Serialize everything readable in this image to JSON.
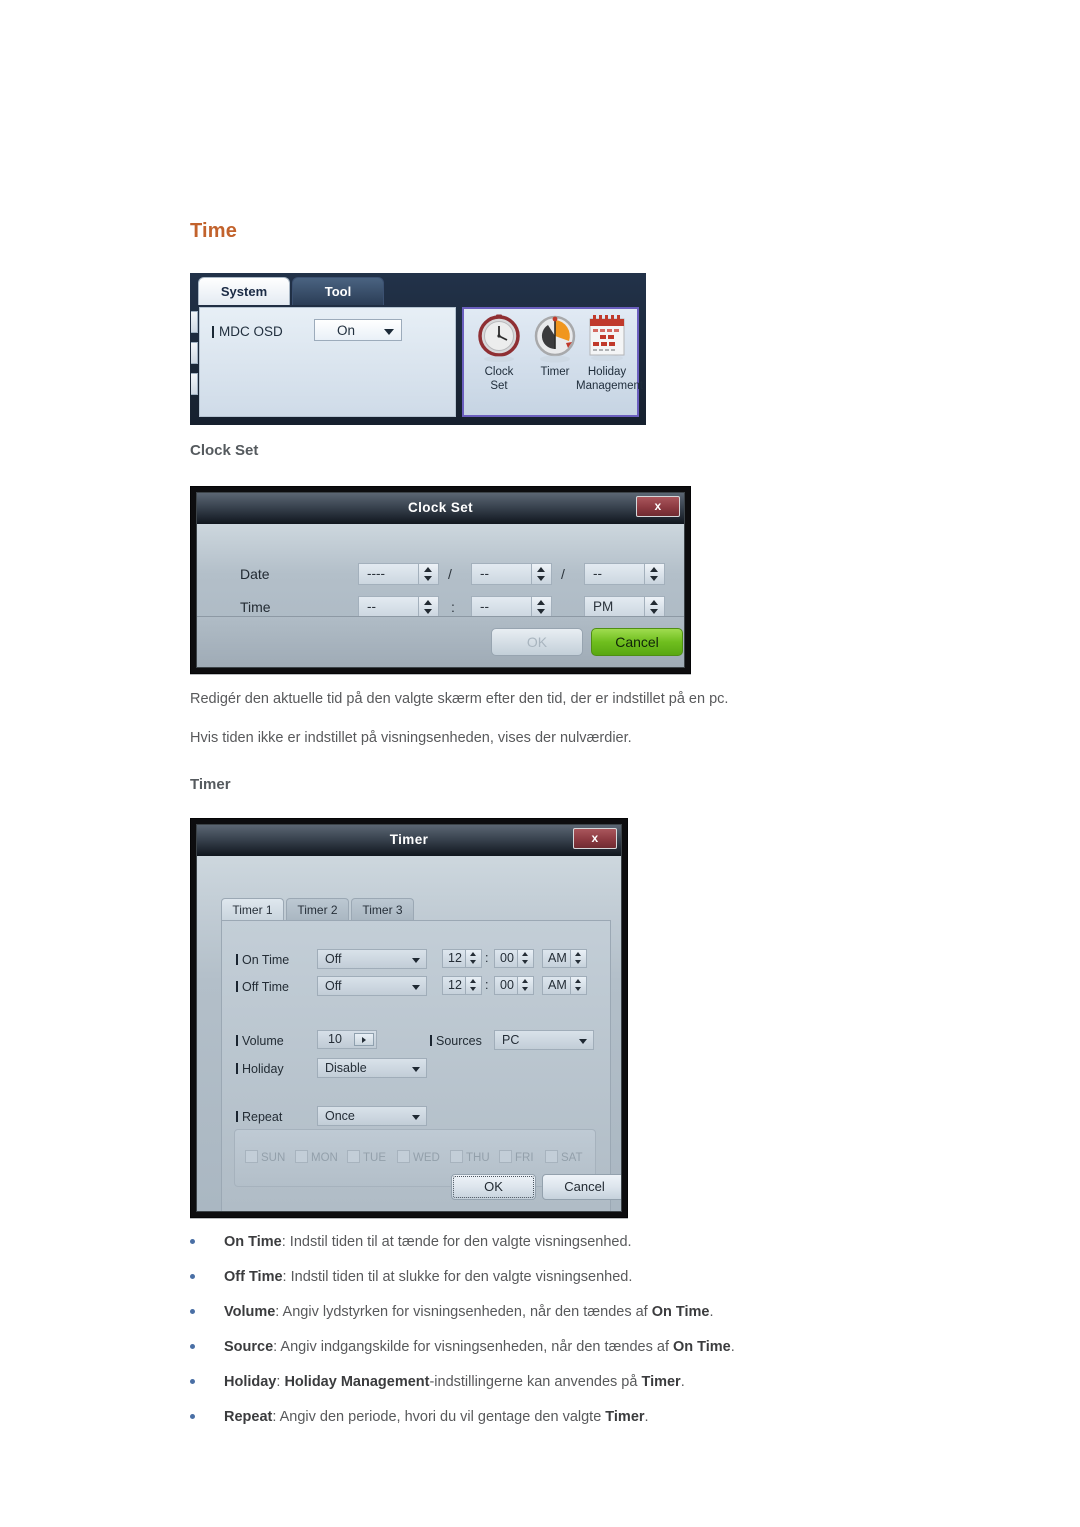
{
  "page": {
    "title": "Time",
    "title_color": "#c2622c",
    "sections": [
      {
        "heading": "Clock Set"
      },
      {
        "heading": "Timer"
      }
    ],
    "paragraphs": [
      "Redigér den aktuelle tid på den valgte skærm efter den tid, der er indstillet på en pc.",
      "Hvis tiden ikke er indstillet på visningsenheden, vises der nulværdier."
    ]
  },
  "mdc_panel": {
    "tabs": [
      {
        "label": "System",
        "active": true
      },
      {
        "label": "Tool",
        "active": false
      }
    ],
    "osd_field": {
      "label": "MDC OSD",
      "value": "On"
    },
    "icons": [
      {
        "name": "clock-set-icon",
        "caption_line1": "Clock",
        "caption_line2": "Set"
      },
      {
        "name": "timer-icon",
        "caption_line1": "Timer",
        "caption_line2": ""
      },
      {
        "name": "holiday-management-icon",
        "caption_line1": "Holiday",
        "caption_line2": "Management"
      }
    ],
    "highlight_color": "#6b5fbf"
  },
  "clock_set_dialog": {
    "title": "Clock Set",
    "close_label": "x",
    "rows": [
      {
        "label": "Date",
        "fields": [
          {
            "value": "----"
          },
          {
            "value": "--"
          },
          {
            "value": "--"
          }
        ],
        "separators": [
          "/",
          "/"
        ]
      },
      {
        "label": "Time",
        "fields": [
          {
            "value": "--"
          },
          {
            "value": "--"
          },
          {
            "value": "PM"
          }
        ],
        "separators": [
          ":"
        ]
      }
    ],
    "buttons": {
      "ok": "OK",
      "ok_enabled": false,
      "cancel": "Cancel",
      "cancel_color": "#6fbe1e"
    }
  },
  "timer_dialog": {
    "title": "Timer",
    "close_label": "x",
    "tabs": [
      {
        "label": "Timer 1",
        "active": true
      },
      {
        "label": "Timer 2",
        "active": false
      },
      {
        "label": "Timer 3",
        "active": false
      }
    ],
    "on_time": {
      "label": "On Time",
      "mode": "Off",
      "hour": "12",
      "minute": "00",
      "meridiem": "AM"
    },
    "off_time": {
      "label": "Off Time",
      "mode": "Off",
      "hour": "12",
      "minute": "00",
      "meridiem": "AM"
    },
    "volume": {
      "label": "Volume",
      "value": "10"
    },
    "sources": {
      "label": "Sources",
      "value": "PC"
    },
    "holiday": {
      "label": "Holiday",
      "value": "Disable"
    },
    "repeat": {
      "label": "Repeat",
      "value": "Once"
    },
    "days": [
      "SUN",
      "MON",
      "TUE",
      "WED",
      "THU",
      "FRI",
      "SAT"
    ],
    "days_enabled": false,
    "buttons": {
      "ok": "OK",
      "cancel": "Cancel"
    }
  },
  "bullets": [
    {
      "term": "On Time",
      "rest": ": Indstil tiden til at tænde for den valgte visningsenhed."
    },
    {
      "term": "Off Time",
      "rest": ": Indstil tiden til at slukke for den valgte visningsenhed."
    },
    {
      "term": "Volume",
      "rest": ": Angiv lydstyrken for visningsenheden, når den tændes af ",
      "term2": "On Time",
      "tail": "."
    },
    {
      "term": "Source",
      "rest": ": Angiv indgangskilde for visningsenheden, når den tændes af ",
      "term2": "On Time",
      "tail": "."
    },
    {
      "term": "Holiday",
      "rest": ": ",
      "term2": "Holiday Management",
      "rest2": "-indstillingerne kan anvendes på ",
      "term3": "Timer",
      "tail": "."
    },
    {
      "term": "Repeat",
      "rest": ": Angiv den periode, hvori du vil gentage den valgte ",
      "term2": "Timer",
      "tail": "."
    }
  ]
}
